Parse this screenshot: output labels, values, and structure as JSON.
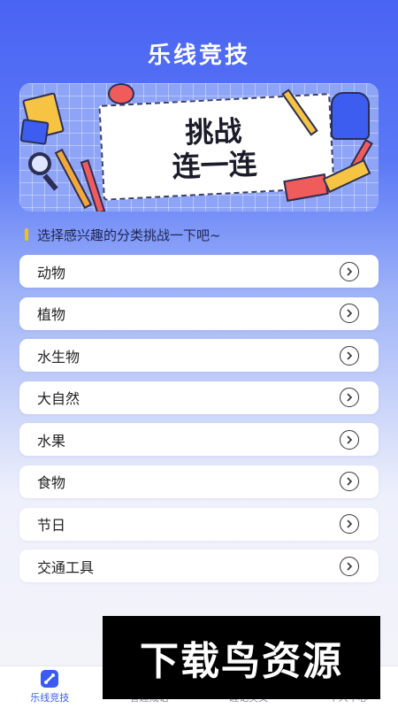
{
  "app_title": "乐线竞技",
  "banner": {
    "line1": "挑战",
    "line2": "连一连"
  },
  "section_label": "选择感兴趣的分类挑战一下吧~",
  "categories": [
    {
      "label": "动物"
    },
    {
      "label": "植物"
    },
    {
      "label": "水生物"
    },
    {
      "label": "大自然"
    },
    {
      "label": "水果"
    },
    {
      "label": "食物"
    },
    {
      "label": "节日"
    },
    {
      "label": "交通工具"
    }
  ],
  "tabbar": {
    "tabs": [
      {
        "label": "乐线竞技",
        "icon": "link-icon",
        "active": true
      },
      {
        "label": "智趣成语",
        "icon": "idiom-icon",
        "active": false
      },
      {
        "label": "趣记英文",
        "icon": "english-icon",
        "active": false
      },
      {
        "label": "个人中心",
        "icon": "user-icon",
        "active": false
      }
    ]
  },
  "watermark": "下载鸟资源",
  "colors": {
    "accent": "#3b5bf0",
    "header_blue": "#4a63f3",
    "section_bar": "#f4c20d"
  }
}
